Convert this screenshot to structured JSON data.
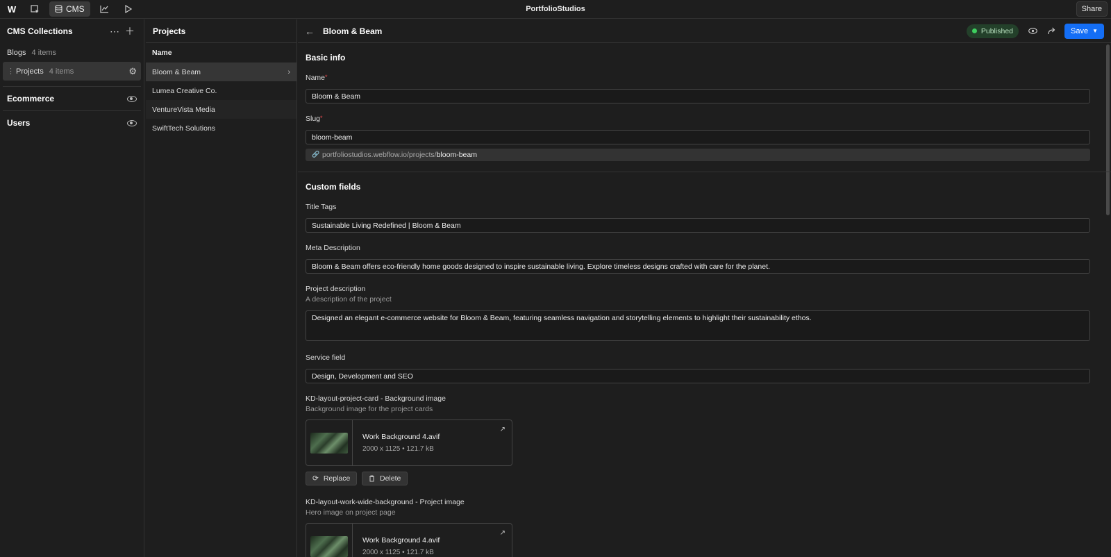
{
  "topbar": {
    "logo": "W",
    "cms_label": "CMS",
    "app_title": "PortfolioStudios",
    "share_label": "Share"
  },
  "collections": {
    "title": "CMS Collections",
    "items": [
      {
        "name": "Blogs",
        "count": "4 items"
      },
      {
        "name": "Projects",
        "count": "4 items"
      }
    ],
    "sections": [
      "Ecommerce",
      "Users"
    ]
  },
  "projects": {
    "title": "Projects",
    "column_header": "Name",
    "rows": [
      "Bloom & Beam",
      "Lumea Creative Co.",
      "VentureVista Media",
      "SwiftTech Solutions"
    ]
  },
  "editor": {
    "item_title": "Bloom & Beam",
    "status": "Published",
    "save_label": "Save",
    "basic_info": "Basic info",
    "name_label": "Name",
    "name_value": "Bloom & Beam",
    "slug_label": "Slug",
    "slug_value": "bloom-beam",
    "slug_url_base": "portfoliostudios.webflow.io/projects/",
    "slug_url_slug": "bloom-beam",
    "custom_fields": "Custom fields",
    "title_tags_label": "Title Tags",
    "title_tags_value": "Sustainable Living Redefined | Bloom & Beam",
    "meta_desc_label": "Meta Description",
    "meta_desc_value": "Bloom & Beam offers eco-friendly home goods designed to inspire sustainable living. Explore timeless designs crafted with care for the planet.",
    "project_desc_label": "Project description",
    "project_desc_hint": "A description of the project",
    "project_desc_value": "Designed an elegant e-commerce website for Bloom & Beam, featuring seamless navigation and storytelling elements to highlight their sustainability ethos.",
    "service_label": "Service field",
    "service_value": "Design, Development and SEO",
    "bg_image_label": "KD-layout-project-card - Background image",
    "bg_image_hint": "Background image for the project cards",
    "bg_image_file": "Work Background 4.avif",
    "bg_image_meta": "2000 x 1125 • 121.7 kB",
    "replace_label": "Replace",
    "delete_label": "Delete",
    "proj_image_label": "KD-layout-work-wide-background - Project image",
    "proj_image_hint": "Hero image on project page",
    "proj_image_file": "Work Background 4.avif",
    "proj_image_meta": "2000 x 1125 • 121.7 kB"
  },
  "colors": {
    "accent": "#146ef5",
    "published": "#3ecf5f",
    "required": "#e5484d"
  }
}
